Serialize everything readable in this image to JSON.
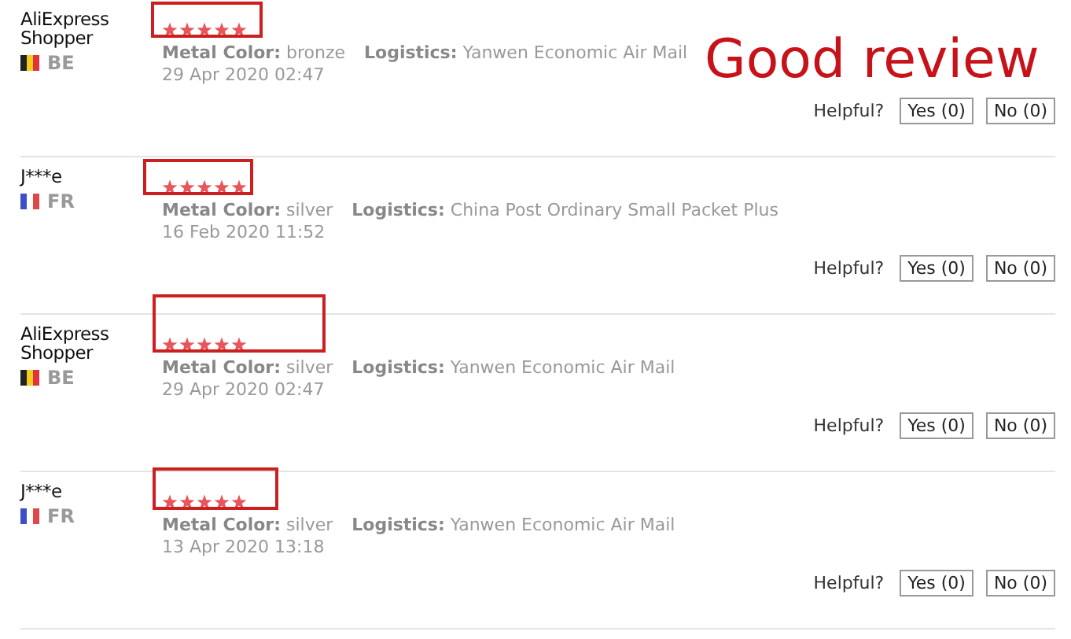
{
  "annotation": "Good review",
  "reviews": [
    {
      "name": "AliExpress Shopper",
      "flag": {
        "kind": "belgium"
      },
      "country": "BE",
      "stars": 5,
      "highlighted": true,
      "attributes": [
        "**Metal Color:** bronze",
        "**Logistics:** Yanwen Economic Air Mail"
      ],
      "date": "29 Apr 2020 02:47",
      "helpful_label": "Helpful?",
      "buttons": [
        "Yes (0)",
        "No (0)"
      ]
    },
    {
      "name": "J***e",
      "flag": {
        "kind": "france"
      },
      "country": "FR",
      "stars": 5,
      "highlighted": true,
      "attributes": [
        "**Metal Color:** silver",
        "**Logistics:** China Post Ordinary Small Packet Plus"
      ],
      "date": "16 Feb 2020 11:52",
      "helpful_label": "Helpful?",
      "buttons": [
        "Yes (0)",
        "No (0)"
      ]
    },
    {
      "name": "AliExpress Shopper",
      "flag": {
        "kind": "belgium"
      },
      "country": "BE",
      "stars": 5,
      "highlighted": true,
      "attributes": [
        "**Metal Color:** silver",
        "**Logistics:** Yanwen Economic Air Mail"
      ],
      "date": "29 Apr 2020 02:47",
      "helpful_label": "Helpful?",
      "buttons": [
        "Yes (0)",
        "No (0)"
      ]
    },
    {
      "name": "J***e",
      "flag": {
        "kind": "france"
      },
      "country": "FR",
      "stars": 5,
      "highlighted": true,
      "attributes": [
        "**Metal Color:** silver",
        "**Logistics:** Yanwen Economic Air Mail"
      ],
      "date": "13 Apr 2020 13:18",
      "helpful_label": "Helpful?",
      "buttons": [
        "Yes (0)",
        "No (0)"
      ]
    }
  ]
}
